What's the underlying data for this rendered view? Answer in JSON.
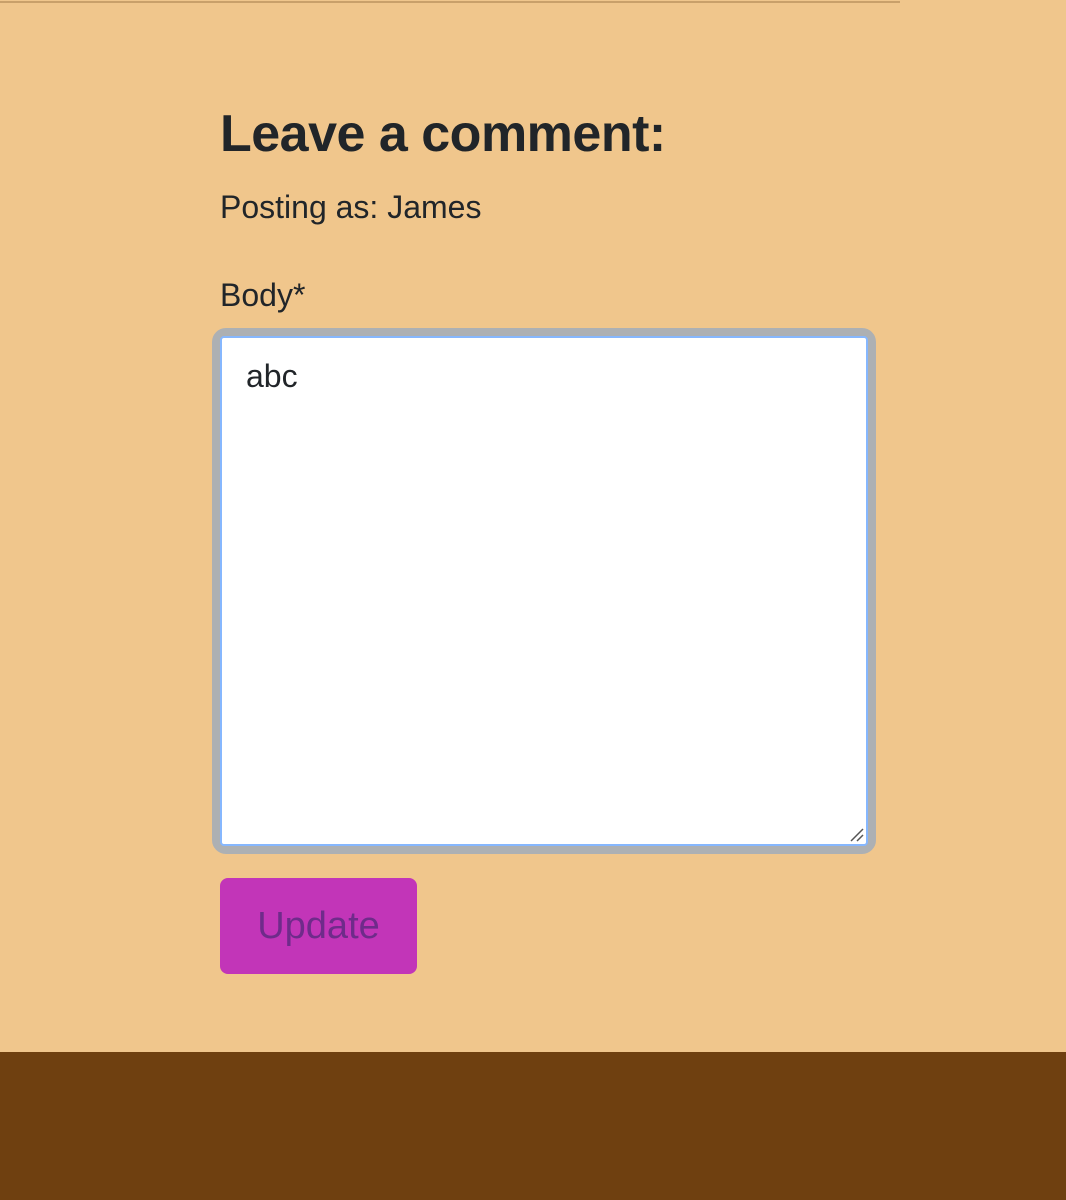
{
  "comment_form": {
    "heading": "Leave a comment:",
    "posting_as": "Posting as: James",
    "body_label": "Body*",
    "body_value": "abc",
    "submit_label": "Update"
  },
  "colors": {
    "page_background": "#f0c68c",
    "footer_background": "#6f4010",
    "button_background": "#c235b8",
    "button_text": "#6f2b8a",
    "focus_ring": "#adb0b3",
    "focus_border": "#86b7fe"
  },
  "icons": {
    "resize_handle": "resize-grip-icon"
  }
}
